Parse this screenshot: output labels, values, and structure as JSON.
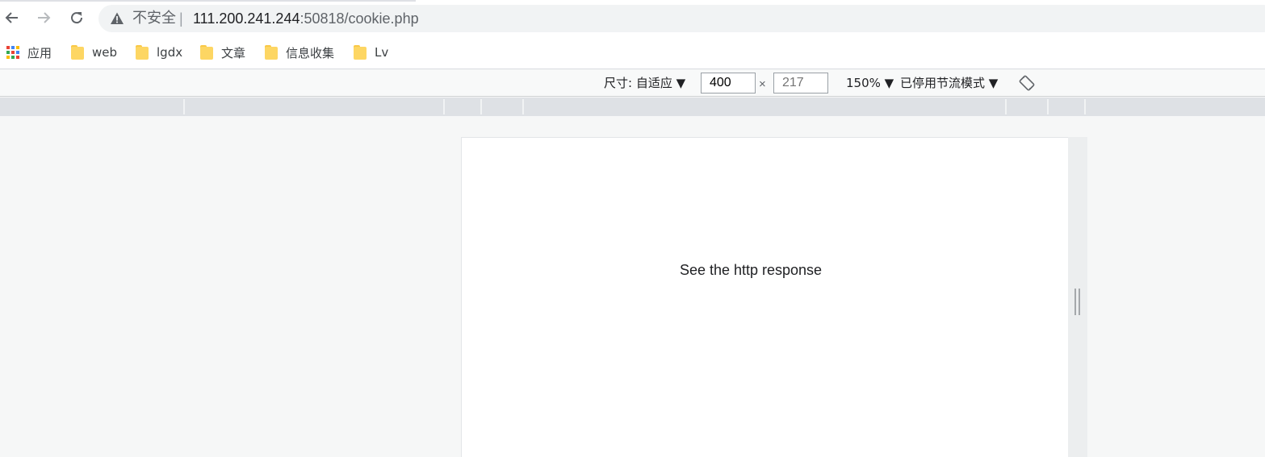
{
  "browser": {
    "security_label": "不安全",
    "url_separator": "|",
    "url_host": "111.200.241.244",
    "url_rest": ":50818/cookie.php"
  },
  "bookmarks": [
    {
      "label": "应用",
      "icon": "apps-grid-icon"
    },
    {
      "label": "web",
      "icon": "folder-icon"
    },
    {
      "label": "lgdx",
      "icon": "folder-icon"
    },
    {
      "label": "文章",
      "icon": "folder-icon"
    },
    {
      "label": "信息收集",
      "icon": "folder-icon"
    },
    {
      "label": "Lv",
      "icon": "folder-icon"
    }
  ],
  "device_toolbar": {
    "size_dropdown": "尺寸: 自适应 ▼",
    "width": "400",
    "separator": "×",
    "height_placeholder": "217",
    "zoom_dropdown": "150% ▼",
    "throttle_dropdown": "已停用节流模式 ▼"
  },
  "page": {
    "message": "See the http response"
  },
  "colors": {
    "folder": "#fdd663",
    "apps_grid": [
      "#ea4335",
      "#fbbc04",
      "#34a853",
      "#4285f4"
    ]
  }
}
